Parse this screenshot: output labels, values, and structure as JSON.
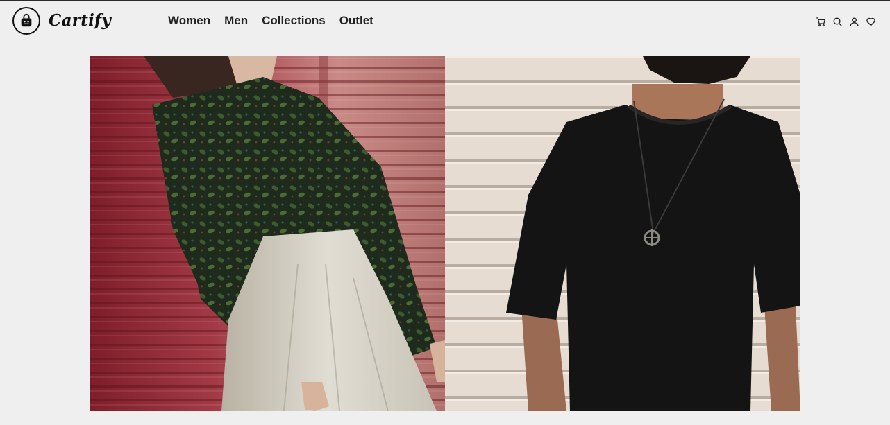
{
  "header": {
    "brand": "Cartify",
    "logo_icon": "shopping-bag-icon",
    "nav": [
      {
        "label": "Women"
      },
      {
        "label": "Men"
      },
      {
        "label": "Collections"
      },
      {
        "label": "Outlet"
      }
    ],
    "icons": [
      "cart-icon",
      "search-icon",
      "user-icon",
      "heart-icon"
    ]
  },
  "hero": {
    "panels": [
      {
        "subject": "women"
      },
      {
        "subject": "men"
      }
    ]
  },
  "colors": {
    "background": "#efefef",
    "text": "#222222",
    "topline": "#2b2b2b"
  }
}
